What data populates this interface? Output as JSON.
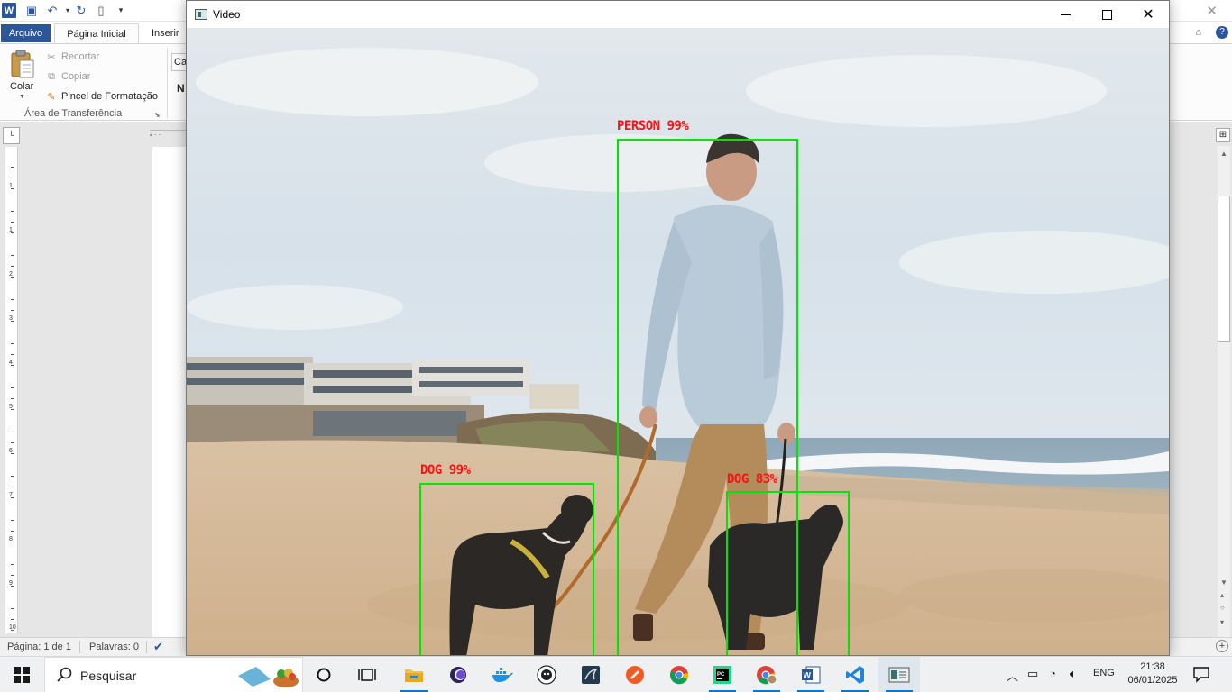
{
  "word": {
    "app_letter": "W",
    "tabs": {
      "file": "Arquivo",
      "home": "Página Inicial",
      "insert": "Inserir"
    },
    "ribbon": {
      "paste": "Colar",
      "cut": "Recortar",
      "copy": "Copiar",
      "format_painter": "Pincel de Formatação",
      "group_clipboard": "Área de Transferência",
      "font_name_partial": "Ca",
      "bold_partial": "N"
    },
    "ruler_numbers": [
      "1",
      "1",
      "2",
      "3",
      "4",
      "5",
      "6",
      "7",
      "8",
      "9",
      "10"
    ],
    "status": {
      "page": "Página: 1 de 1",
      "words": "Palavras: 0"
    }
  },
  "video_window": {
    "title": "Video",
    "detections": [
      {
        "label": "PERSON 99%",
        "class": "person",
        "confidence": 0.99
      },
      {
        "label": "DOG 99%",
        "class": "dog",
        "confidence": 0.99
      },
      {
        "label": "DOG 83%",
        "class": "dog",
        "confidence": 0.83
      }
    ],
    "box_color": "#00e600",
    "label_color": "#ff1111"
  },
  "taskbar": {
    "search_placeholder": "Pesquisar",
    "apps": [
      "cortana-icon",
      "task-view-icon",
      "file-explorer-icon",
      "eclipse-icon",
      "docker-icon",
      "github-desktop-icon",
      "mysql-workbench-icon",
      "postman-icon",
      "chrome-icon",
      "pycharm-icon",
      "chrome-profile-icon",
      "word-icon",
      "vscode-icon",
      "video-app-icon"
    ],
    "tray": {
      "language": "ENG",
      "time": "21:38",
      "date": "06/01/2025"
    }
  }
}
